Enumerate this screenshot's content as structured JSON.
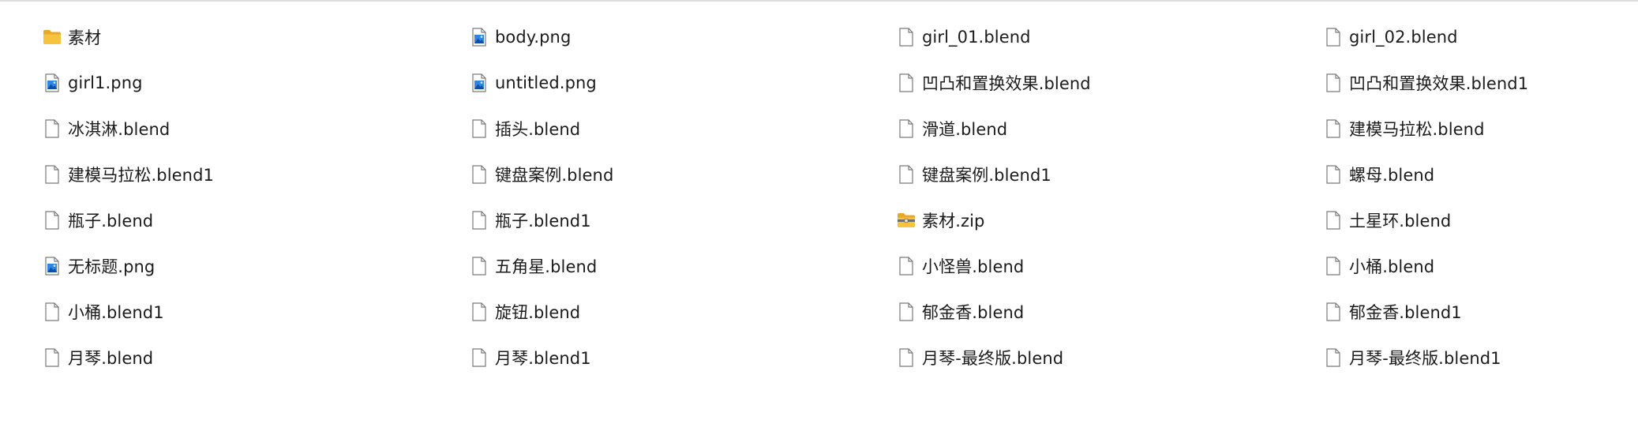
{
  "files": [
    {
      "name": "素材",
      "type": "folder"
    },
    {
      "name": "body.png",
      "type": "image"
    },
    {
      "name": "girl_01.blend",
      "type": "file"
    },
    {
      "name": "girl_02.blend",
      "type": "file"
    },
    {
      "name": "girl1.png",
      "type": "image"
    },
    {
      "name": "untitled.png",
      "type": "image"
    },
    {
      "name": "凹凸和置换效果.blend",
      "type": "file"
    },
    {
      "name": "凹凸和置换效果.blend1",
      "type": "file"
    },
    {
      "name": "冰淇淋.blend",
      "type": "file"
    },
    {
      "name": "插头.blend",
      "type": "file"
    },
    {
      "name": "滑道.blend",
      "type": "file"
    },
    {
      "name": "建模马拉松.blend",
      "type": "file"
    },
    {
      "name": "建模马拉松.blend1",
      "type": "file"
    },
    {
      "name": "键盘案例.blend",
      "type": "file"
    },
    {
      "name": "键盘案例.blend1",
      "type": "file"
    },
    {
      "name": "螺母.blend",
      "type": "file"
    },
    {
      "name": "瓶子.blend",
      "type": "file"
    },
    {
      "name": "瓶子.blend1",
      "type": "file"
    },
    {
      "name": "素材.zip",
      "type": "zip"
    },
    {
      "name": "土星环.blend",
      "type": "file"
    },
    {
      "name": "无标题.png",
      "type": "image"
    },
    {
      "name": "五角星.blend",
      "type": "file"
    },
    {
      "name": "小怪兽.blend",
      "type": "file"
    },
    {
      "name": "小桶.blend",
      "type": "file"
    },
    {
      "name": "小桶.blend1",
      "type": "file"
    },
    {
      "name": "旋钮.blend",
      "type": "file"
    },
    {
      "name": "郁金香.blend",
      "type": "file"
    },
    {
      "name": "郁金香.blend1",
      "type": "file"
    },
    {
      "name": "月琴.blend",
      "type": "file"
    },
    {
      "name": "月琴.blend1",
      "type": "file"
    },
    {
      "name": "月琴-最终版.blend",
      "type": "file"
    },
    {
      "name": "月琴-最终版.blend1",
      "type": "file"
    }
  ],
  "icons": {
    "folder": "folder-icon",
    "image": "image-file-icon",
    "file": "file-icon",
    "zip": "zip-folder-icon"
  },
  "colors": {
    "folder": "#F8C33C",
    "image_blue": "#1E73D8",
    "file_outline": "#7A7A7A",
    "text": "#1B1B1B"
  }
}
